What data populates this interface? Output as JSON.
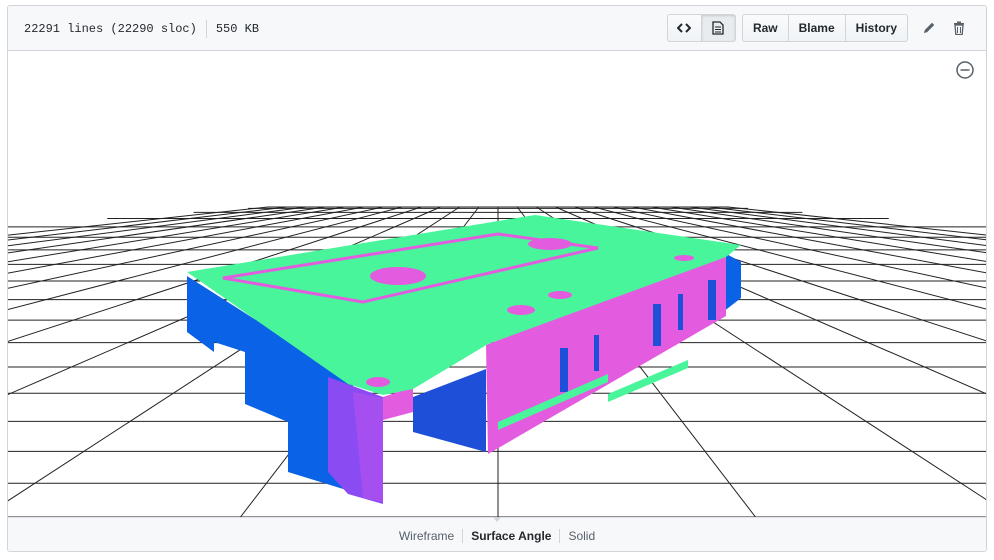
{
  "file_info": {
    "lines": "22291 lines (22290 sloc)",
    "size": "550 KB"
  },
  "toolbar": {
    "source_icon": "code-icon",
    "rendered_icon": "file-icon",
    "raw_label": "Raw",
    "blame_label": "Blame",
    "history_label": "History",
    "edit_icon": "pencil-icon",
    "delete_icon": "trash-icon"
  },
  "viewer": {
    "zoom_icon": "minus-circle-icon",
    "colors": {
      "top_face": "#48f59a",
      "side_magenta": "#e35ce0",
      "side_blue": "#0a62e6",
      "side_violet": "#8a4cf2",
      "grid": "#222222"
    }
  },
  "view_modes": {
    "items": [
      "Wireframe",
      "Surface Angle",
      "Solid"
    ],
    "active": "Surface Angle"
  }
}
